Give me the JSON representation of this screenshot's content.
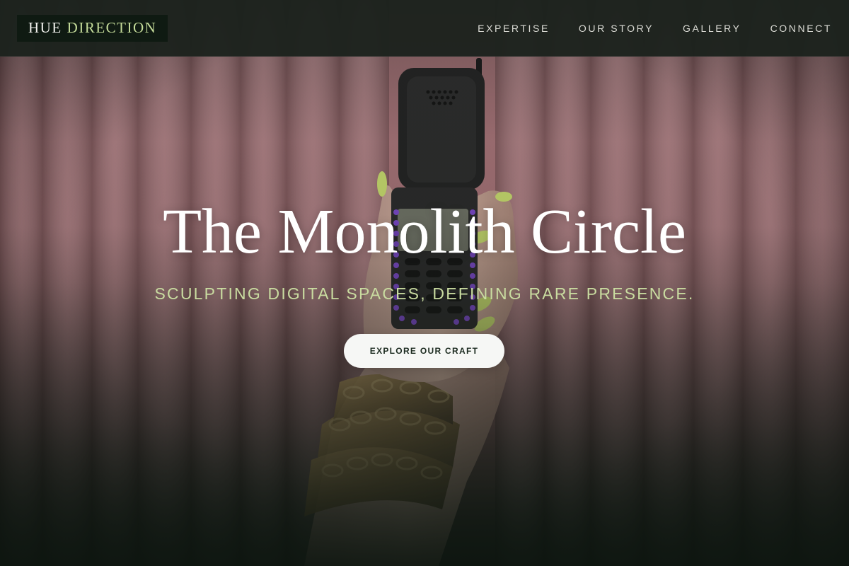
{
  "brand": {
    "word1": "HUE",
    "word2": "DIRECTION"
  },
  "nav": {
    "items": [
      {
        "label": "EXPERTISE"
      },
      {
        "label": "OUR STORY"
      },
      {
        "label": "GALLERY"
      },
      {
        "label": "CONNECT"
      }
    ]
  },
  "hero": {
    "title": "The Monolith Circle",
    "subtitle": "SCULPTING DIGITAL SPACES, DEFINING RARE PRESENCE.",
    "cta_label": "EXPLORE OUR CRAFT",
    "image_subject": "hand-holding-flip-phone-photo"
  },
  "colors": {
    "header_bg": "#1c221d",
    "logo_bg": "#0f1a12",
    "accent_green": "#c5dc9a",
    "curtain_pink": "#c48a90",
    "cta_bg": "#f6f7f5",
    "cta_text": "#1b2a1f"
  }
}
